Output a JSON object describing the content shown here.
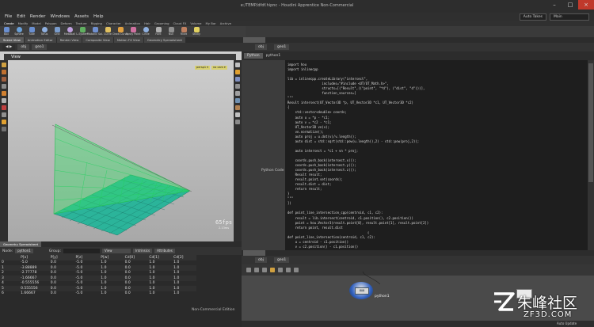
{
  "window": {
    "title": "e:/TEMP/dfdf.hipnc - Houdini Apprentice Non-Commercial"
  },
  "menu": [
    "File",
    "Edit",
    "Render",
    "Windows",
    "Assets",
    "Help"
  ],
  "menu_right": {
    "auto_takes": "Auto Takes",
    "desktop": "Main"
  },
  "shelf_tabs": [
    "Create",
    "Modify",
    "Model",
    "Polygon",
    "Deform",
    "Texture",
    "Rigging",
    "Character",
    "Animation",
    "Hair",
    "Grooming",
    "Cloud FX",
    "Volume",
    "My Bar",
    "Archive"
  ],
  "shelf_tools": [
    "Box",
    "Sphere",
    "Tube",
    "Torus",
    "Grid",
    "Metaball",
    "L-System",
    "Platonic Sol.",
    "Curve",
    "Draw Curve",
    "Spray Paint",
    "Circle",
    "Font",
    "Null",
    "Rivet",
    "Sticky"
  ],
  "left_tabs": [
    "Scene View",
    "Animation Editor",
    "Render View",
    "Composite View",
    "Motion FX View",
    "Geometry Spreadsheet"
  ],
  "path": {
    "obj": "obj",
    "geo": "geo1"
  },
  "viewport": {
    "label": "View",
    "cam_chips": [
      "persp1 ▾",
      "no cam ▾"
    ],
    "fps": "65fps",
    "fps_sub": "2.13ms"
  },
  "sheet": {
    "tab": "Geometry Spreadsheet",
    "node_label": "Node:",
    "node": "python1",
    "group_label": "Group:",
    "view_label": "View",
    "intrinsics": "Intrinsics",
    "attributes": "Attributes",
    "columns": [
      "",
      "P[x]",
      "P[y]",
      "P[z]",
      "P[w]",
      "Cd[0]",
      "Cd[1]",
      "Cd[2]"
    ],
    "rows": [
      [
        "0",
        "-5.0",
        "0.0",
        "-5.0",
        "1.0",
        "0.0",
        "1.0",
        "1.0"
      ],
      [
        "1",
        "-3.88889",
        "0.0",
        "-5.0",
        "1.0",
        "0.0",
        "1.0",
        "1.0"
      ],
      [
        "2",
        "-2.77778",
        "0.0",
        "-5.0",
        "1.0",
        "0.0",
        "1.0",
        "1.0"
      ],
      [
        "3",
        "-1.66667",
        "0.0",
        "-5.0",
        "1.0",
        "0.0",
        "1.0",
        "1.0"
      ],
      [
        "4",
        "-0.555556",
        "0.0",
        "-5.0",
        "1.0",
        "0.0",
        "1.0",
        "1.0"
      ],
      [
        "5",
        "0.555556",
        "0.0",
        "-5.0",
        "1.0",
        "0.0",
        "1.0",
        "1.0"
      ],
      [
        "6",
        "1.66667",
        "0.0",
        "-5.0",
        "1.0",
        "0.0",
        "1.0",
        "1.0"
      ]
    ],
    "non_commercial": "Non-Commercial Edition"
  },
  "code_panel": {
    "tab": "Python",
    "node": "python1",
    "side_label": "Python Code"
  },
  "code_lines": [
    "import hou",
    "import inlinecpp",
    "",
    "lib = inlinecpp.createLibrary(\"intersect\",",
    "                  includes=\"#include <UT/UT_Math.h>\",",
    "                  structs=[(\"Result\",((\"point\", \"*d\"), (\"dist\", \"d\")))],",
    "                  function_sources=[",
    "\"\"\"",
    "Result intersect(UT_Vector3D *p, UT_Vector3D *c1, UT_Vector3D *c2)",
    "{",
    "    std::vector<double> coords;",
    "    auto u = *p - *c1;",
    "    auto v = *c2 - *c1;",
    "    UT_Vector3D vn(v);",
    "    vn.normalize();",
    "    auto proj = u.dot(v)/v.length();",
    "    auto dist = std::sqrt(std::pow(u.length(),2) - std::pow(proj,2));",
    "",
    "    auto intersect = *c1 + vn * proj;",
    "",
    "    coords.push_back(intersect.x());",
    "    coords.push_back(intersect.y());",
    "    coords.push_back(intersect.z());",
    "    Result result;",
    "    result.point.set(coords);",
    "    result.dist = dist;",
    "    return result;",
    "}",
    "\"\"\"",
    "])",
    "",
    "def point_line_intersection_cpp(centroid, c1, c2):",
    "    result = lib.intersect(centroid, c1.position(), c2.position())",
    "    point = hou.Vector3(result.point[0], result.point[1], result.point[2])",
    "    return point, result.dist",
    "                                          ▯",
    "def point_line_intersection(centroid, c1, c2):",
    "    u = centroid - c1.position()",
    "    v = c2.position() - c1.position()",
    "",
    "    proj = u.dot(v) / v.length()",
    "    dist = math.sqrt(math.pow(u.length(), 2) - math.pow(proj, 2))",
    "    intersect = c1.position() + (v.normalized() * proj)",
    "    return intersect, dist"
  ],
  "network": {
    "tab": "Network View",
    "node_name": "python1"
  },
  "status": {
    "auto_update": "Auto Update"
  },
  "watermark": {
    "cn": "朱峰社区",
    "url": "ZF3D.COM"
  },
  "colors": {
    "accent": "#e8a030",
    "geo_green": "#3adf6a",
    "grid_teal": "#2aa896"
  }
}
